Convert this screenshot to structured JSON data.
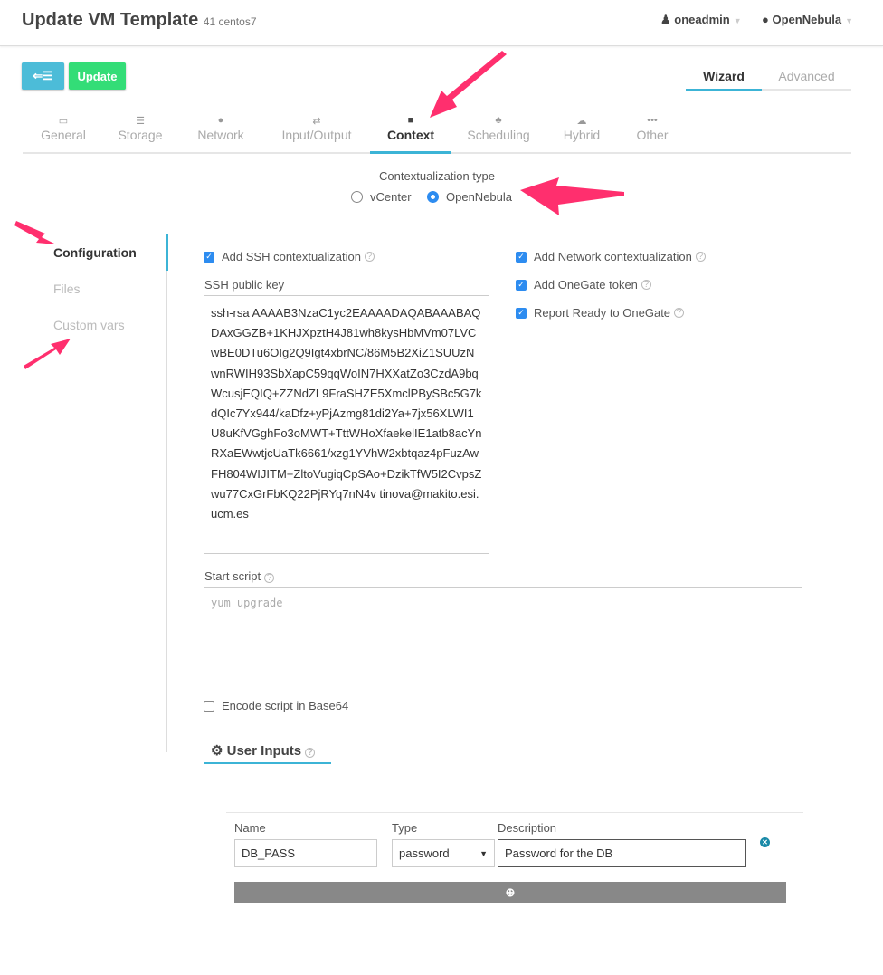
{
  "header": {
    "title": "Update VM Template",
    "subtitle": "41 centos7",
    "user": "oneadmin",
    "zone": "OpenNebula"
  },
  "toolbar": {
    "back_icon": "back-list-icon",
    "update_label": "Update",
    "wizard_label": "Wizard",
    "advanced_label": "Advanced"
  },
  "tabs": [
    {
      "label": "General",
      "icon": "laptop-icon"
    },
    {
      "label": "Storage",
      "icon": "tasks-icon"
    },
    {
      "label": "Network",
      "icon": "globe-icon"
    },
    {
      "label": "Input/Output",
      "icon": "exchange-icon"
    },
    {
      "label": "Context",
      "icon": "folder-icon"
    },
    {
      "label": "Scheduling",
      "icon": "sitemap-icon"
    },
    {
      "label": "Hybrid",
      "icon": "cloud-icon"
    },
    {
      "label": "Other",
      "icon": "ellipsis-icon"
    }
  ],
  "context_type": {
    "label": "Contextualization type",
    "options": [
      "vCenter",
      "OpenNebula"
    ],
    "selected": "OpenNebula"
  },
  "sidebar": {
    "items": [
      {
        "label": "Configuration",
        "active": true
      },
      {
        "label": "Files"
      },
      {
        "label": "Custom vars"
      }
    ]
  },
  "config": {
    "ssh_ctx": {
      "label": "Add SSH contextualization",
      "checked": true
    },
    "network_ctx": {
      "label": "Add Network contextualization",
      "checked": true
    },
    "onegate": {
      "label": "Add OneGate token",
      "checked": true
    },
    "report_ready": {
      "label": "Report Ready to OneGate",
      "checked": true
    },
    "ssh_key_label": "SSH public key",
    "ssh_key": "ssh-rsa AAAAB3NzaC1yc2EAAAADAQABAAABAQDAxGGZB+1KHJXpztH4J81wh8kysHbMVm07LVCwBE0DTu6OIg2Q9Igt4xbrNC/86M5B2XiZ1SUUzNwnRWIH93SbXapC59qqWoIN7HXXatZo3CzdA9bqWcusjEQIQ+ZZNdZL9FraSHZE5XmclPBySBc5G7kdQIc7Yx944/kaDfz+yPjAzmg81di2Ya+7jx56XLWI1U8uKfVGghFo3oMWT+TttWHoXfaekelIE1atb8acYnRXaEWwtjcUaTk6661/xzg1YVhW2xbtqaz4pFuzAwFH804WIJITM+ZltoVugiqCpSAo+DzikTfW5I2CvpsZwu77CxGrFbKQ22PjRYq7nN4v tinova@makito.esi.ucm.es",
    "start_script_label": "Start script",
    "start_script_placeholder": "yum upgrade",
    "encode_base64": {
      "label": "Encode script in Base64",
      "checked": false
    }
  },
  "user_inputs": {
    "title": "User Inputs",
    "headers": [
      "Name",
      "Type",
      "Description"
    ],
    "rows": [
      {
        "name": "DB_PASS",
        "type": "password",
        "description": "Password for the DB"
      }
    ]
  },
  "colors": {
    "accent": "#3cb4d6",
    "update": "#33dd77",
    "back": "#4cbcd8",
    "arrow": "#ff2f6e"
  }
}
